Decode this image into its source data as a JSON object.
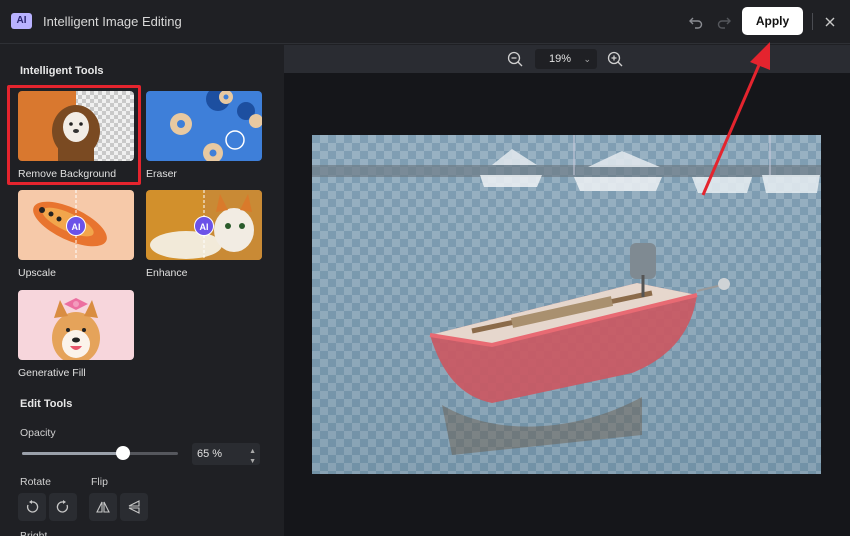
{
  "window": {
    "title": "Intelligent Image Editing",
    "badge": "AI",
    "apply_label": "Apply"
  },
  "panel": {
    "intelligent_tools_title": "Intelligent Tools",
    "tools": [
      {
        "label": "Remove Background",
        "selected": true
      },
      {
        "label": "Eraser",
        "selected": false
      },
      {
        "label": "Upscale",
        "selected": false,
        "badge": "AI"
      },
      {
        "label": "Enhance",
        "selected": false,
        "badge": "AI"
      },
      {
        "label": "Generative Fill",
        "selected": false
      }
    ],
    "edit_tools_title": "Edit Tools",
    "opacity": {
      "label": "Opacity",
      "value": "65 %",
      "fraction": 0.65
    },
    "rotate_label": "Rotate",
    "flip_label": "Flip",
    "cut_label": "Bright"
  },
  "canvas": {
    "zoom": "19%"
  },
  "colors": {
    "accent": "#e4242e",
    "badge": "#b9b2ff",
    "ai_badge": "#6b52e8"
  },
  "icons": [
    "undo-icon",
    "redo-icon",
    "close-icon",
    "zoom-out-icon",
    "zoom-in-icon",
    "chevron-down-icon",
    "rotate-left-icon",
    "rotate-right-icon",
    "flip-horizontal-icon",
    "flip-vertical-icon"
  ]
}
